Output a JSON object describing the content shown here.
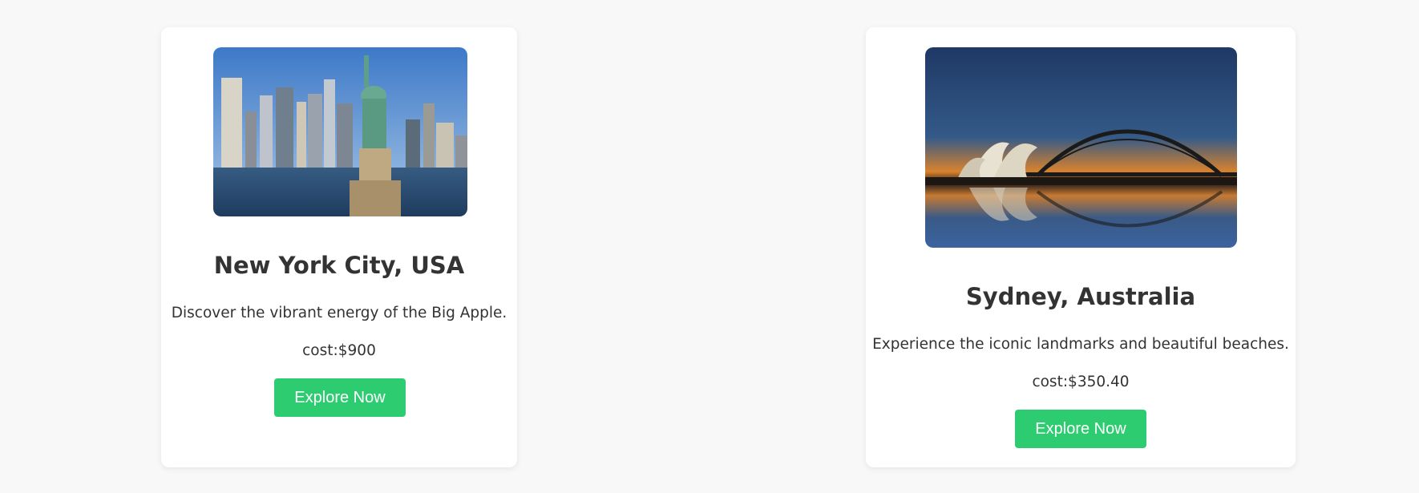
{
  "destinations": [
    {
      "title": "New York City, USA",
      "description": "Discover the vibrant energy of the Big Apple.",
      "cost": "cost:$900",
      "button_label": "Explore Now",
      "image": "new-york-skyline-statue-of-liberty-photo"
    },
    {
      "title": "Sydney, Australia",
      "description": "Experience the iconic landmarks and beautiful beaches.",
      "cost": "cost:$350.40",
      "button_label": "Explore Now",
      "image": "sydney-opera-house-harbour-bridge-photo"
    }
  ],
  "colors": {
    "page_background": "#f8f8f8",
    "card_background": "#ffffff",
    "button_background": "#2ecc71",
    "button_text": "#ffffff",
    "text": "#333333"
  }
}
